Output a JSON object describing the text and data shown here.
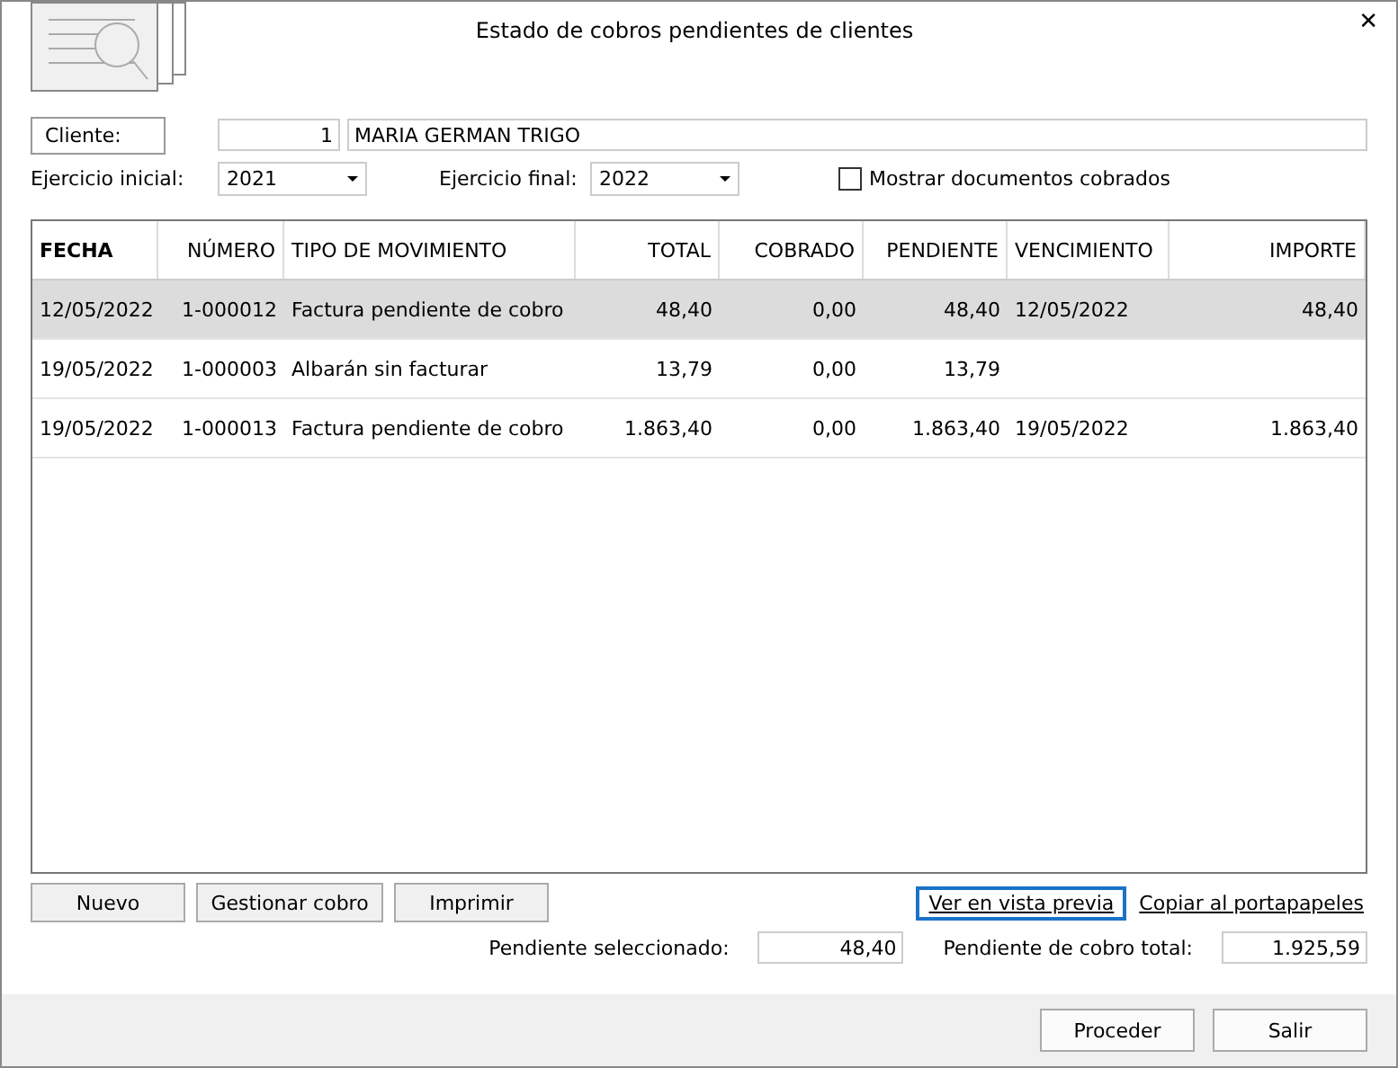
{
  "window": {
    "title": "Estado de cobros pendientes de clientes",
    "close": "✕"
  },
  "client": {
    "label": "Cliente:",
    "number": "1",
    "name": "MARIA GERMAN TRIGO"
  },
  "filters": {
    "start_label": "Ejercicio inicial:",
    "start_value": "2021",
    "end_label": "Ejercicio final:",
    "end_value": "2022",
    "show_paid": {
      "label": "Mostrar documentos cobrados",
      "checked": false
    }
  },
  "table": {
    "columns": [
      {
        "label": "FECHA",
        "kind": "text",
        "bold": true
      },
      {
        "label": "NÚMERO",
        "kind": "number",
        "bold": false
      },
      {
        "label": "TIPO DE MOVIMIENTO",
        "kind": "text",
        "bold": false
      },
      {
        "label": "TOTAL",
        "kind": "number",
        "bold": false
      },
      {
        "label": "COBRADO",
        "kind": "number",
        "bold": false
      },
      {
        "label": "PENDIENTE",
        "kind": "number",
        "bold": false
      },
      {
        "label": "VENCIMIENTO",
        "kind": "text",
        "bold": false
      },
      {
        "label": "IMPORTE",
        "kind": "number",
        "bold": false
      }
    ],
    "rows": [
      {
        "selected": true,
        "cells": [
          "12/05/2022",
          "1-000012",
          "Factura pendiente de cobro",
          "48,40",
          "0,00",
          "48,40",
          "12/05/2022",
          "48,40"
        ]
      },
      {
        "selected": false,
        "cells": [
          "19/05/2022",
          "1-000003",
          "Albarán sin facturar",
          "13,79",
          "0,00",
          "13,79",
          "",
          ""
        ]
      },
      {
        "selected": false,
        "cells": [
          "19/05/2022",
          "1-000013",
          "Factura pendiente de cobro",
          "1.863,40",
          "0,00",
          "1.863,40",
          "19/05/2022",
          "1.863,40"
        ]
      }
    ]
  },
  "actions": [
    "Nuevo",
    "Gestionar cobro",
    "Imprimir"
  ],
  "links": [
    {
      "label": "Ver en vista previa",
      "focused": true
    },
    {
      "label": "Copiar al portapapeles",
      "focused": false
    }
  ],
  "totals": [
    {
      "label": "Pendiente seleccionado:",
      "value": "48,40"
    },
    {
      "label": "Pendiente de cobro total:",
      "value": "1.925,59"
    }
  ],
  "footer_buttons": [
    "Proceder",
    "Salir"
  ]
}
